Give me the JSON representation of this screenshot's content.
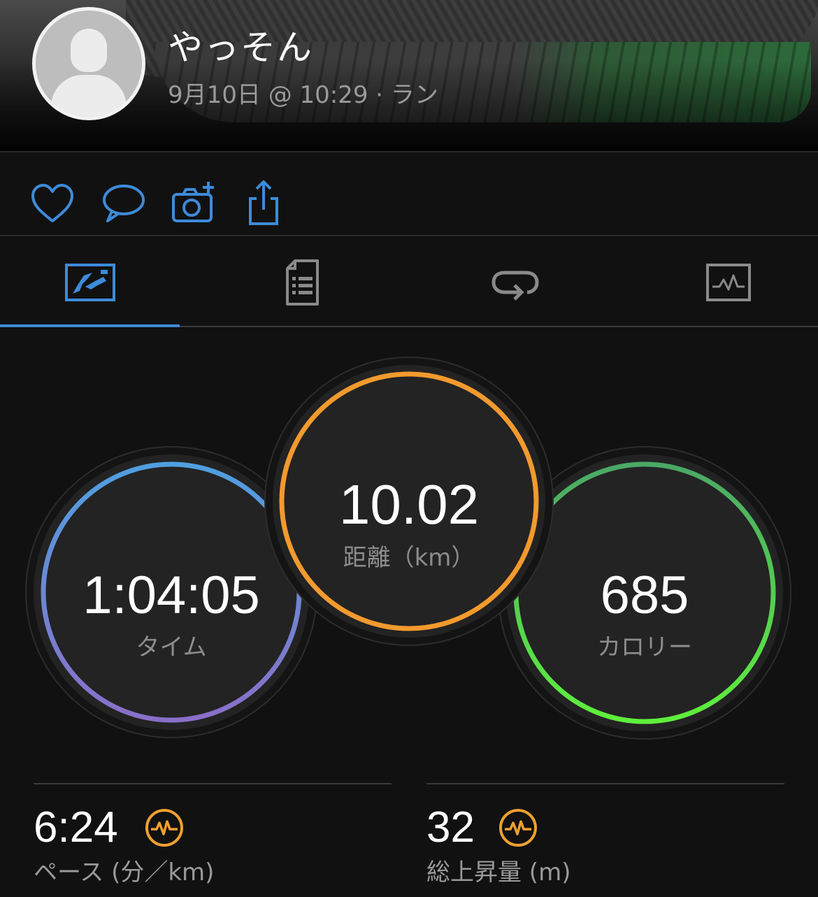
{
  "header": {
    "user_name": "やっそん",
    "activity_meta": "9月10日 @ 10:29 · ラン"
  },
  "actions": [
    {
      "icon": "heart-icon"
    },
    {
      "icon": "comment-icon"
    },
    {
      "icon": "add-photo-icon"
    },
    {
      "icon": "share-icon"
    }
  ],
  "tabs": [
    {
      "icon": "map-summary-icon",
      "active": true
    },
    {
      "icon": "details-list-icon",
      "active": false
    },
    {
      "icon": "laps-icon",
      "active": false
    },
    {
      "icon": "charts-icon",
      "active": false
    }
  ],
  "rings": {
    "time": {
      "value": "1:04:05",
      "label": "タイム"
    },
    "distance": {
      "value": "10.02",
      "label": "距離（km）"
    },
    "calories": {
      "value": "685",
      "label": "カロリー"
    }
  },
  "stats": [
    {
      "value": "6:24",
      "label": "ペース (分／km)",
      "icon": "performance-icon"
    },
    {
      "value": "32",
      "label": "総上昇量 (m)",
      "icon": "performance-icon"
    }
  ],
  "colors": {
    "accent": "#3d8bd8",
    "distance_ring": "#f29a2e",
    "icon_orange": "#f0a030"
  }
}
